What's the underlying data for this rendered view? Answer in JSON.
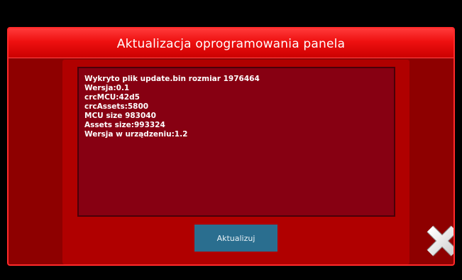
{
  "dialog": {
    "title": "Aktualizacja oprogramowania panela",
    "info_lines": [
      "Wykryto plik update.bin rozmiar 1976464",
      "Wersja:0.1",
      "crcMCU:42d5",
      "crcAssets:5800",
      "MCU size 983040",
      "Assets size:993324",
      "Wersja w urządzeniu:1.2"
    ],
    "update_button_label": "Aktualizuj",
    "close_icon": "close-x-icon"
  },
  "colors": {
    "title_bar": "#ee1010",
    "dialog_background": "#8e0000",
    "info_box": "#870012",
    "button": "#2a6e8f"
  }
}
